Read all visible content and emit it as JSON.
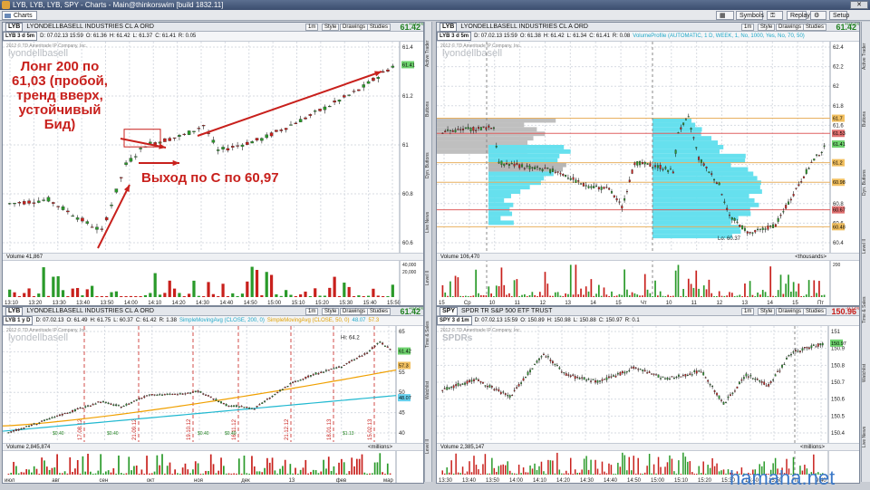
{
  "window": {
    "title": "LYB, LYB, LYB, SPY - Charts - Main@thinkorswim [build 1832.11]",
    "tab": "Charts"
  },
  "toolbar": {
    "symbols": "Symbols",
    "replay": "Replay",
    "setup": "Setup"
  },
  "panels": [
    {
      "symbol": "LYB",
      "desc": "LYONDELLBASELL INDUSTRIES CL A ORD",
      "agg": "LYB 3 d 5m",
      "info": [
        "D: 07.02.13 15:59",
        "O: 61.36",
        "H: 61.42",
        "L: 61.37",
        "C: 61.41",
        "R: 0.05"
      ],
      "price": "61.42",
      "pct": "+0.61%",
      "wm": "lyondellbasell",
      "copy": "2012 © TD Ameritrade IP Company, Inc.",
      "yticks": [
        "61.4",
        "61.2",
        "61",
        "60.8",
        "60.6"
      ],
      "xticks": [
        "13:10",
        "13:20",
        "13:30",
        "13:40",
        "13:50",
        "14:00",
        "14:10",
        "14:20",
        "14:30",
        "14:40",
        "14:50",
        "15:00",
        "15:10",
        "15:20",
        "15:30",
        "15:40",
        "15:50"
      ],
      "vol": "Volume  41,867",
      "vticks": [
        "40,000",
        "20,000"
      ],
      "tag": "61.41"
    },
    {
      "symbol": "LYB",
      "desc": "LYONDELLBASELL INDUSTRIES CL A ORD",
      "agg": "LYB 3 d 5m",
      "info": [
        "D: 07.02.13 15:59",
        "O: 61.38",
        "H: 61.42",
        "L: 61.34",
        "C: 61.41",
        "R: 0.08"
      ],
      "study": "VolumeProfile (AUTOMATIC, 1 D, WEEK, 1, No, 1000, Yes, No, 70, 50)",
      "price": "61.42",
      "pct": "+0.61%",
      "wm": "lyondellbasell",
      "copy": "2012 © TD Ameritrade IP Company, Inc.",
      "yticks": [
        "62.4",
        "62.2",
        "62",
        "61.8",
        "61.6",
        "61.4",
        "61.2",
        "61",
        "60.8",
        "60.6",
        "60.4"
      ],
      "xticks": [
        "15",
        "Ср",
        "10",
        "11",
        "12",
        "13",
        "14",
        "15",
        "Чт",
        "10",
        "11",
        "12",
        "13",
        "14",
        "15",
        "Пт"
      ],
      "vol": "Volume  106,470",
      "vunit": "<thousands>",
      "vticks": [
        "200"
      ],
      "lo": "Lo: 60.37",
      "tags": [
        "61.7",
        "61.53",
        "61.41",
        "61.2",
        "60.98",
        "60.67",
        "60.48"
      ]
    },
    {
      "symbol": "LYB",
      "desc": "LYONDELLBASELL INDUSTRIES CL A ORD",
      "agg": "LYB 1 y D",
      "info": [
        "D: 07.02.13",
        "O: 61.49",
        "H: 61.75",
        "L: 60.37",
        "C: 61.42",
        "R: 1.38"
      ],
      "study": "SimpleMovingAvg (CLOSE, 200, 0)",
      "study2": "SimpleMovingAvg (CLOSE, 50, 0)",
      "sv1": "48.07",
      "sv2": "57.3",
      "price": "61.42",
      "pct": "+0.61%",
      "wm": "lyondellbasell",
      "copy": "2012 © TD Ameritrade IP Company, Inc.",
      "yticks": [
        "65",
        "60",
        "55",
        "50",
        "45",
        "40"
      ],
      "xticks": [
        "июл",
        "авг",
        "сен",
        "окт",
        "ноя",
        "дек",
        "13",
        "фев",
        "мар"
      ],
      "vol": "Volume  2,845,874",
      "vunit": "<millions>",
      "hi": "Hi: 64.2",
      "tags": [
        "61.42",
        "57.3",
        "48.07"
      ],
      "dates": [
        "17.08.12",
        "21.09.12",
        "19.10.12",
        "16.11.12",
        "21.12.12",
        "18.01.13",
        "15.02.13"
      ],
      "divs": [
        "$0.40",
        "$0.40",
        "$0.40",
        "$0.40",
        "$1.13"
      ]
    },
    {
      "symbol": "SPY",
      "desc": "SPDR TR S&P 500 ETF TRUST",
      "agg": "SPY 3 d 1m",
      "info": [
        "D: 07.02.13 15:59",
        "O: 150.89",
        "H: 150.98",
        "L: 150.88",
        "C: 150.97",
        "R: 0.1"
      ],
      "price": "150.96",
      "pct": "-0.17%",
      "wm": "SPDRs",
      "copy": "2012 © TD Ameritrade IP Company, Inc.",
      "yticks": [
        "151",
        "150.9",
        "150.8",
        "150.7",
        "150.6",
        "150.5",
        "150.4"
      ],
      "xticks": [
        "13:30",
        "13:40",
        "13:50",
        "14:00",
        "14:10",
        "14:20",
        "14:30",
        "14:40",
        "14:50",
        "15:00",
        "15:10",
        "15:20",
        "15:30",
        "15:40",
        "15:50",
        "Пт",
        "9:40"
      ],
      "vol": "Volume  2,385,147",
      "vunit": "<millions>",
      "tag": "150.97"
    }
  ],
  "annotations": {
    "long": "Лонг 200 по 61,03 (пробой, тренд вверх, устойчивый Бид)",
    "exit": "Выход по С по 60,97"
  },
  "watermark": "hamaha.net",
  "side_left": [
    "Active Trader",
    "Buttons",
    "Dyn. Buttons",
    "Live News",
    "Level II",
    "Time & Sales",
    "Watchlist",
    "Level II"
  ],
  "side_right": [
    "Active Trader",
    "Buttons",
    "Dyn. Buttons",
    "Level II",
    "Time & Sales",
    "Watchlist",
    "Live News"
  ]
}
